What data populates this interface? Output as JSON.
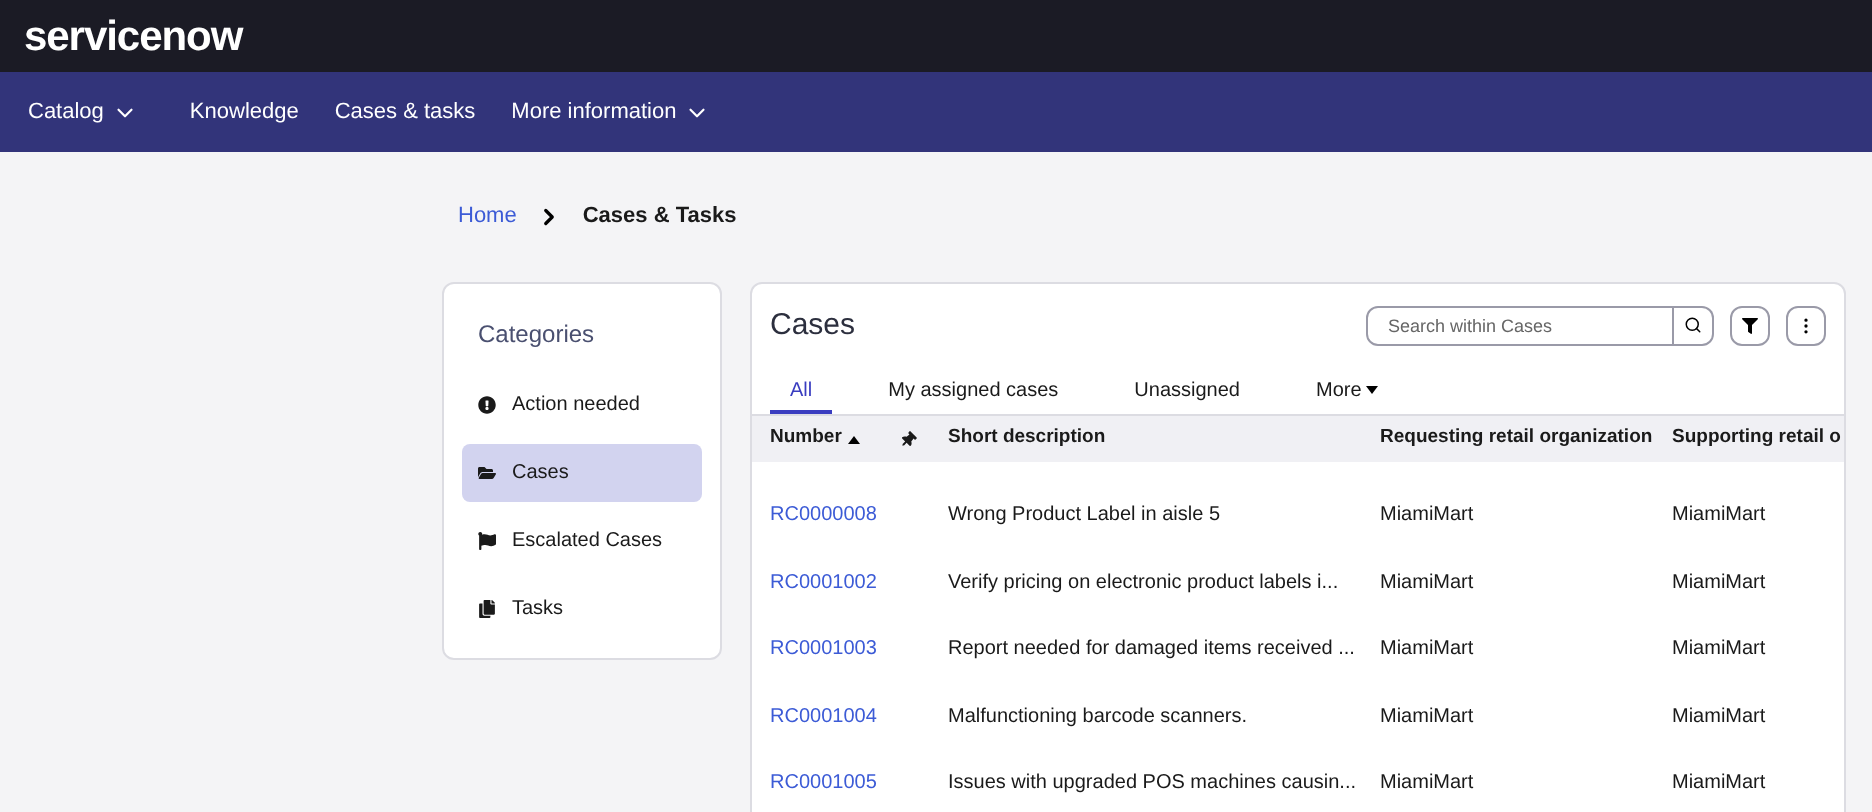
{
  "brand": {
    "logo": "servicenow"
  },
  "nav": [
    {
      "label": "Catalog",
      "dropdown": true
    },
    {
      "label": "Knowledge",
      "dropdown": false
    },
    {
      "label": "Cases & tasks",
      "dropdown": false
    },
    {
      "label": "More information",
      "dropdown": true
    }
  ],
  "breadcrumb": {
    "home": "Home",
    "current": "Cases & Tasks"
  },
  "categories": {
    "title": "Categories",
    "items": [
      {
        "label": "Action needed",
        "kind": "alert",
        "selected": false
      },
      {
        "label": "Cases",
        "kind": "folder",
        "selected": true
      },
      {
        "label": "Escalated Cases",
        "kind": "flag",
        "selected": false
      },
      {
        "label": "Tasks",
        "kind": "copy",
        "selected": false
      }
    ]
  },
  "cases": {
    "title": "Cases",
    "search": {
      "placeholder": "Search within Cases"
    },
    "tabs": [
      {
        "label": "All",
        "selected": true,
        "dropdown": false
      },
      {
        "label": "My assigned cases",
        "selected": false,
        "dropdown": false
      },
      {
        "label": "Unassigned",
        "selected": false,
        "dropdown": false
      },
      {
        "label": "More",
        "selected": false,
        "dropdown": true
      }
    ],
    "table": {
      "columns": [
        {
          "label": "Number",
          "sorted": true
        },
        {
          "label": "Short description",
          "sorted": false
        },
        {
          "label": "Requesting retail organization",
          "sorted": false
        },
        {
          "label": "Supporting retail o",
          "sorted": false
        }
      ],
      "rows": [
        [
          "RC0000008",
          "Wrong Product Label in aisle 5",
          "MiamiMart",
          "MiamiMart"
        ],
        [
          "RC0001002",
          "Verify pricing on electronic product labels i...",
          "MiamiMart",
          "MiamiMart"
        ],
        [
          "RC0001003",
          "Report needed for damaged items received ...",
          "MiamiMart",
          "MiamiMart"
        ],
        [
          "RC0001004",
          "Malfunctioning barcode scanners.",
          "MiamiMart",
          "MiamiMart"
        ],
        [
          "RC0001005",
          "Issues with upgraded POS machines causin...",
          "MiamiMart",
          "MiamiMart"
        ]
      ]
    }
  }
}
